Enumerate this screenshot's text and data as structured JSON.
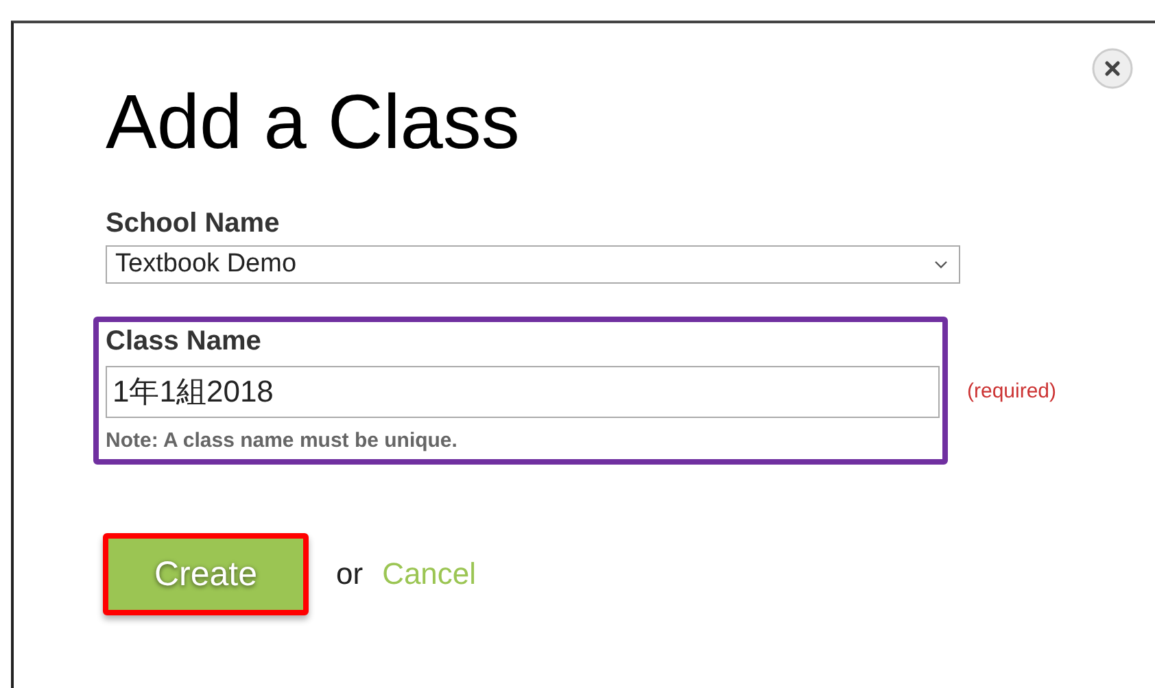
{
  "dialog": {
    "title": "Add a Class"
  },
  "school_name": {
    "label": "School Name",
    "value": "Textbook Demo"
  },
  "class_name": {
    "label": "Class Name",
    "value": "1年1組2018",
    "note": "Note: A class name must be unique.",
    "required_text": "(required)",
    "highlighted": true
  },
  "actions": {
    "create": {
      "label": "Create",
      "highlighted": true
    },
    "separator": "or",
    "cancel": "Cancel"
  }
}
